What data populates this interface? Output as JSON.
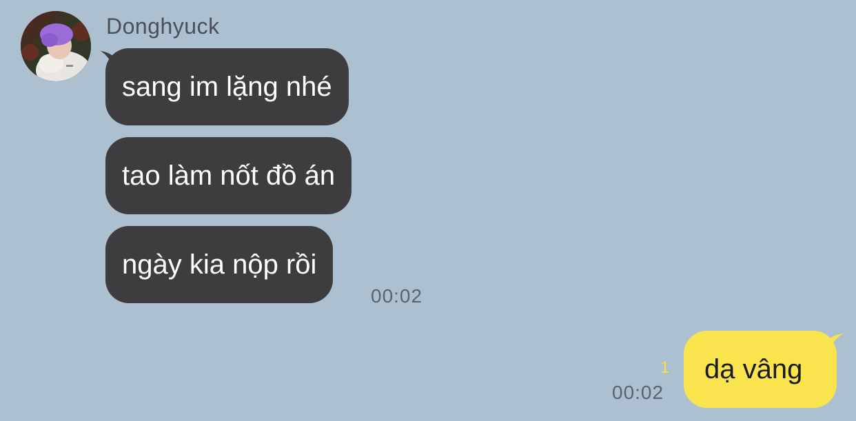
{
  "conversation": {
    "sender": {
      "name": "Donghyuck",
      "avatar_icon": "profile-photo"
    },
    "incoming": [
      {
        "text": "sang im lặng nhé"
      },
      {
        "text": "tao làm nốt đồ án"
      },
      {
        "text": "ngày kia nộp rồi"
      }
    ],
    "incoming_time": "00:02",
    "outgoing": [
      {
        "text": "dạ vâng"
      }
    ],
    "outgoing_time": "00:02",
    "outgoing_unread": "1"
  },
  "colors": {
    "background": "#adc0d0",
    "incoming_bubble": "#3d3d3f",
    "outgoing_bubble": "#f9e44d",
    "unread_count": "#f4e24a"
  }
}
